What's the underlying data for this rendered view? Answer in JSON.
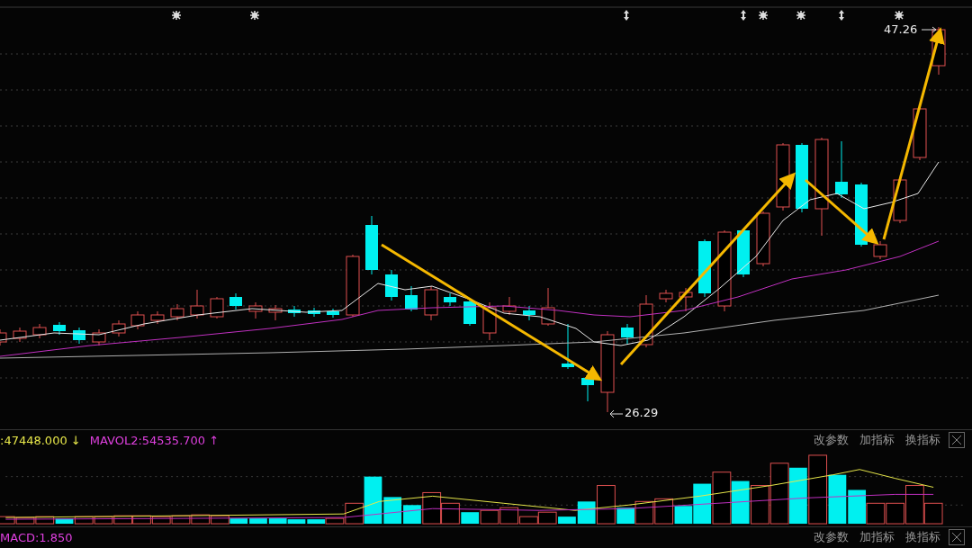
{
  "main_chart": {
    "high_label": "47.26",
    "low_label": "26.29"
  },
  "volume_panel": {
    "indicators": [
      {
        "text": ":47448.000 ↓",
        "kind": "ma1"
      },
      {
        "text": "MAVOL2:54535.700 ↑",
        "kind": "ma2"
      }
    ],
    "buttons": [
      "改参数",
      "加指标",
      "换指标"
    ]
  },
  "macd_panel": {
    "indicators": [
      {
        "text": "MACD:1.850",
        "kind": "macd"
      }
    ],
    "buttons": [
      "改参数",
      "加指标",
      "换指标"
    ]
  }
}
